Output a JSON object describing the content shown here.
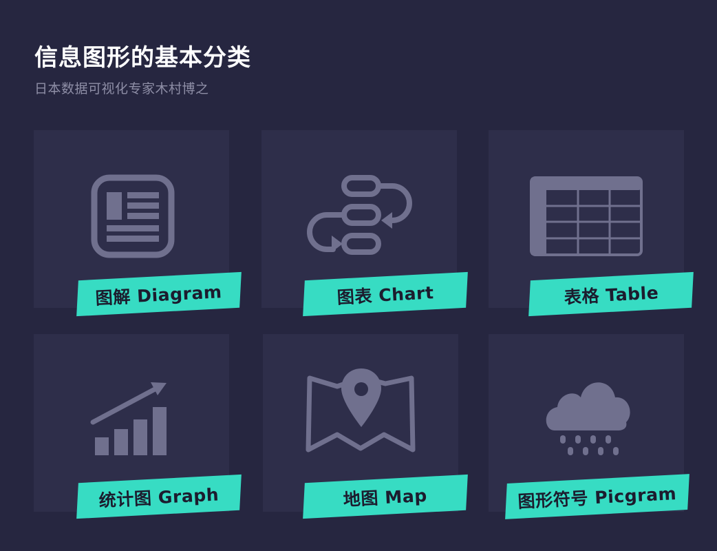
{
  "header": {
    "title": "信息图形的基本分类",
    "subtitle": "日本数据可视化专家木村博之"
  },
  "colors": {
    "background": "#262640",
    "card": "#2e2e4a",
    "icon": "#70708e",
    "tag": "#37dcc3",
    "tag_text": "#1c1c2e"
  },
  "cards": [
    {
      "label": "图解 Diagram",
      "icon": "diagram-icon"
    },
    {
      "label": "图表 Chart",
      "icon": "flowchart-icon"
    },
    {
      "label": "表格 Table",
      "icon": "table-icon"
    },
    {
      "label": "统计图 Graph",
      "icon": "bar-graph-icon"
    },
    {
      "label": "地图 Map",
      "icon": "map-pin-icon"
    },
    {
      "label": "图形符号 Picgram",
      "icon": "rain-cloud-icon"
    }
  ]
}
